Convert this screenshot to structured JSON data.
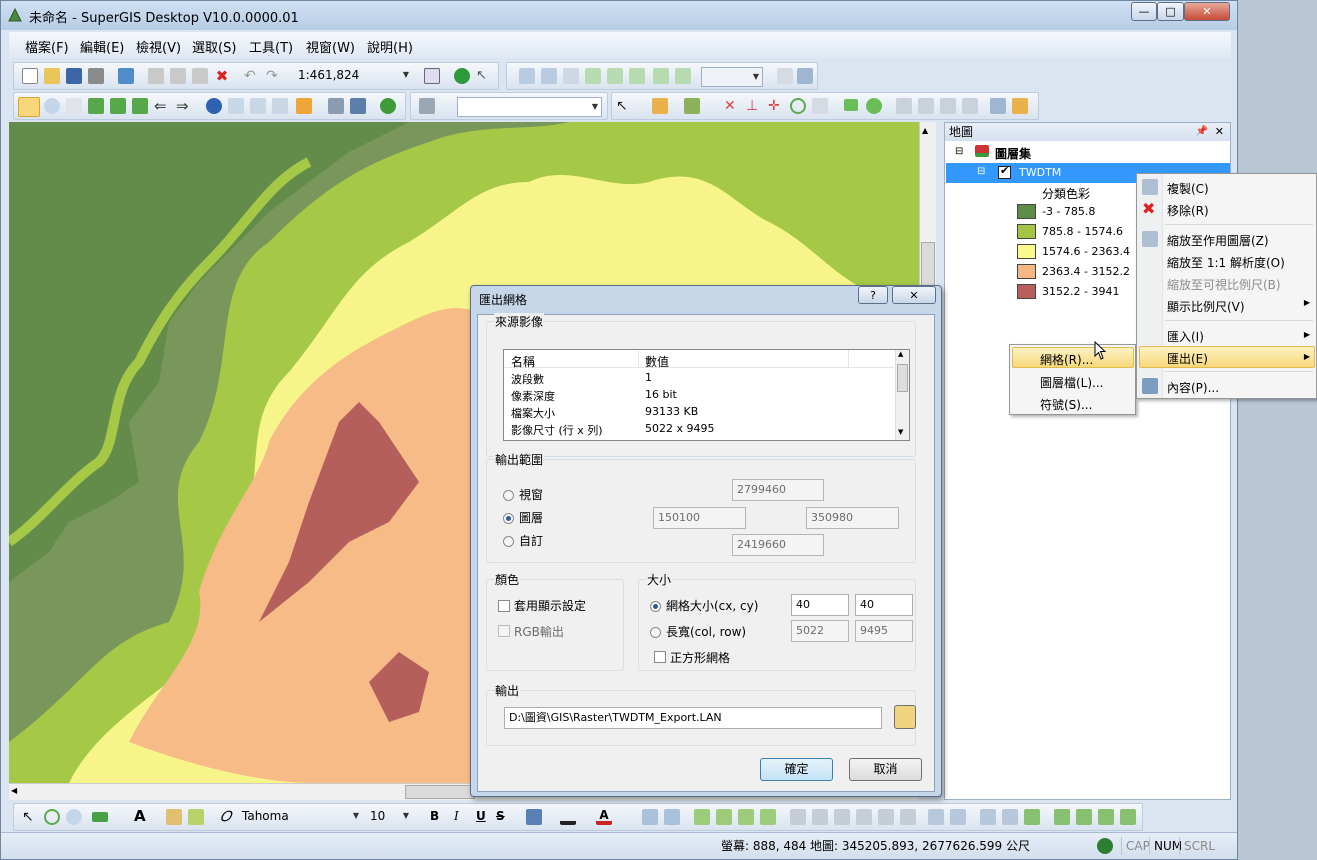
{
  "window": {
    "title": "未命名 - SuperGIS Desktop V10.0.0000.01"
  },
  "menu": [
    "檔案(F)",
    "編輯(E)",
    "檢視(V)",
    "選取(S)",
    "工具(T)",
    "視窗(W)",
    "說明(H)"
  ],
  "toolbar": {
    "scale": "1:461,824",
    "scale_arrow": "▼",
    "font_name": "Tahoma",
    "font_size": "10",
    "italic_glyph": "I",
    "bold_glyph": "B",
    "underline_glyph": "U",
    "strike_glyph": "S"
  },
  "panel": {
    "title": "地圖",
    "pin": "📌",
    "close": "✕",
    "layerset": "圖層集",
    "layer": "TWDTM",
    "legend_title": "分類色彩",
    "legend": [
      {
        "label": "-3 - 785.8",
        "color": "#5e8d47"
      },
      {
        "label": "785.8 - 1574.6",
        "color": "#a3c545"
      },
      {
        "label": "1574.6 - 2363.4",
        "color": "#fafa8c"
      },
      {
        "label": "2363.4 - 3152.2",
        "color": "#f5b885"
      },
      {
        "label": "3152.2 - 3941",
        "color": "#b85f5c"
      }
    ]
  },
  "context_menu": [
    {
      "label": "複製(C)",
      "enabled": true
    },
    {
      "label": "移除(R)",
      "enabled": true
    },
    {
      "label": "縮放至作用圖層(Z)",
      "enabled": true
    },
    {
      "label": "縮放至 1:1 解析度(O)",
      "enabled": true
    },
    {
      "label": "縮放至可視比例尺(B)",
      "enabled": false
    },
    {
      "label": "顯示比例尺(V)",
      "enabled": true
    },
    {
      "label": "匯入(I)",
      "enabled": true
    },
    {
      "label": "匯出(E)",
      "enabled": true
    },
    {
      "label": "內容(P)...",
      "enabled": true
    }
  ],
  "submenu": [
    "網格(R)...",
    "圖層檔(L)...",
    "符號(S)..."
  ],
  "dialog": {
    "title": "匯出網格",
    "help": "?",
    "close": "✕",
    "source": {
      "label": "來源影像",
      "col_name": "名稱",
      "col_value": "數值",
      "rows": [
        {
          "name": "波段數",
          "value": "1"
        },
        {
          "name": "像素深度",
          "value": "16 bit"
        },
        {
          "name": "檔案大小",
          "value": "93133 KB"
        },
        {
          "name": "影像尺寸 (行 x 列)",
          "value": "5022 x 9495"
        }
      ]
    },
    "extent": {
      "label": "輸出範圍",
      "opt_view": "視窗",
      "opt_layer": "圖層",
      "opt_custom": "自訂",
      "selected": "圖層",
      "top": "2799460",
      "left": "150100",
      "right": "350980",
      "bottom": "2419660"
    },
    "color": {
      "label": "顏色",
      "use_display": "套用顯示設定",
      "rgb": "RGB輸出"
    },
    "size": {
      "label": "大小",
      "opt_cell": "網格大小(cx, cy)",
      "opt_dim": "長寬(col, row)",
      "cx": "40",
      "cy": "40",
      "cols": "5022",
      "rows": "9495",
      "square": "正方形網格"
    },
    "output": {
      "label": "輸出",
      "path": "D:\\圖資\\GIS\\Raster\\TWDTM_Export.LAN"
    },
    "ok": "確定",
    "cancel": "取消"
  },
  "status": {
    "screen": "螢幕: 888, 484",
    "map": "地圖: 345205.893, 2677626.599 公尺",
    "cap": "CAP",
    "num": "NUM",
    "scrl": "SCRL"
  }
}
